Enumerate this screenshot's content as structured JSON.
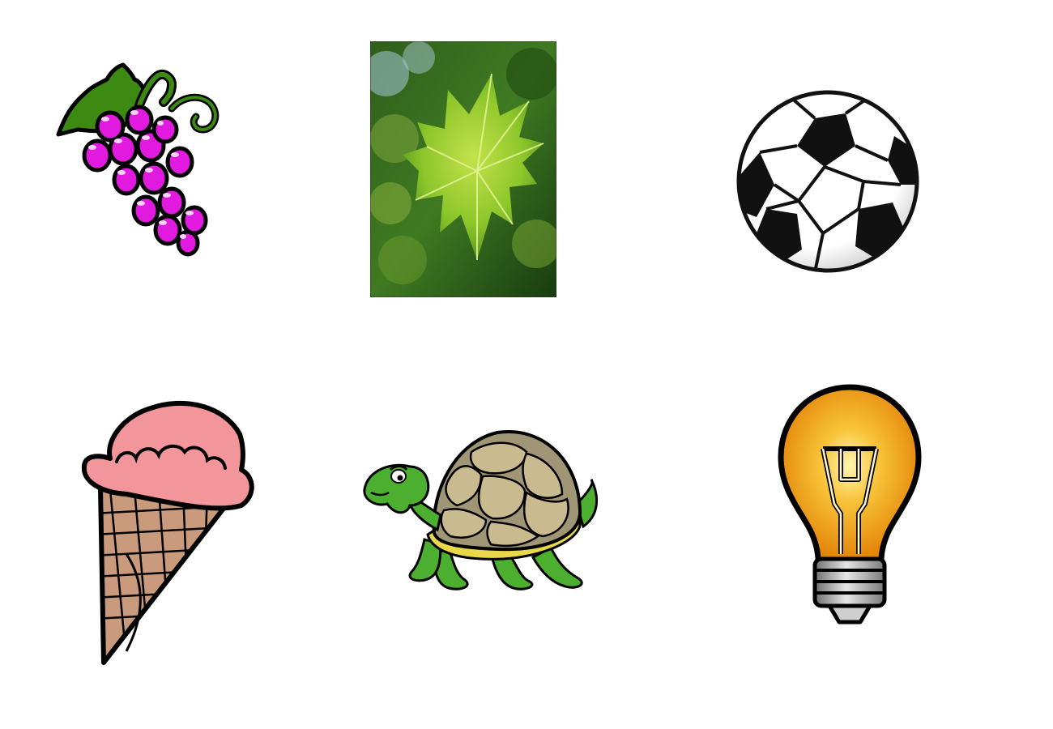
{
  "images": [
    {
      "icon": "grapes-icon",
      "kind": "clipart"
    },
    {
      "icon": "leaf-photo",
      "kind": "photo"
    },
    {
      "icon": "soccer-ball-icon",
      "kind": "clipart"
    },
    {
      "icon": "ice-cream-cone-icon",
      "kind": "clipart"
    },
    {
      "icon": "turtle-icon",
      "kind": "clipart"
    },
    {
      "icon": "light-bulb-icon",
      "kind": "clipart"
    }
  ],
  "colors": {
    "background": "#ffffff",
    "grape": "#e21ae0",
    "grape_leaf": "#3c8a12",
    "leaf_photo_bright": "#9fd12c",
    "leaf_photo_dark": "#1f4a12",
    "ball_dark": "#111111",
    "ice_cream_scoop": "#f2969c",
    "cone": "#c99a7c",
    "turtle_skin": "#4caf2f",
    "turtle_shell": "#a09675",
    "bulb_glow": "#f3a410",
    "bulb_base": "#9c9c9c"
  }
}
